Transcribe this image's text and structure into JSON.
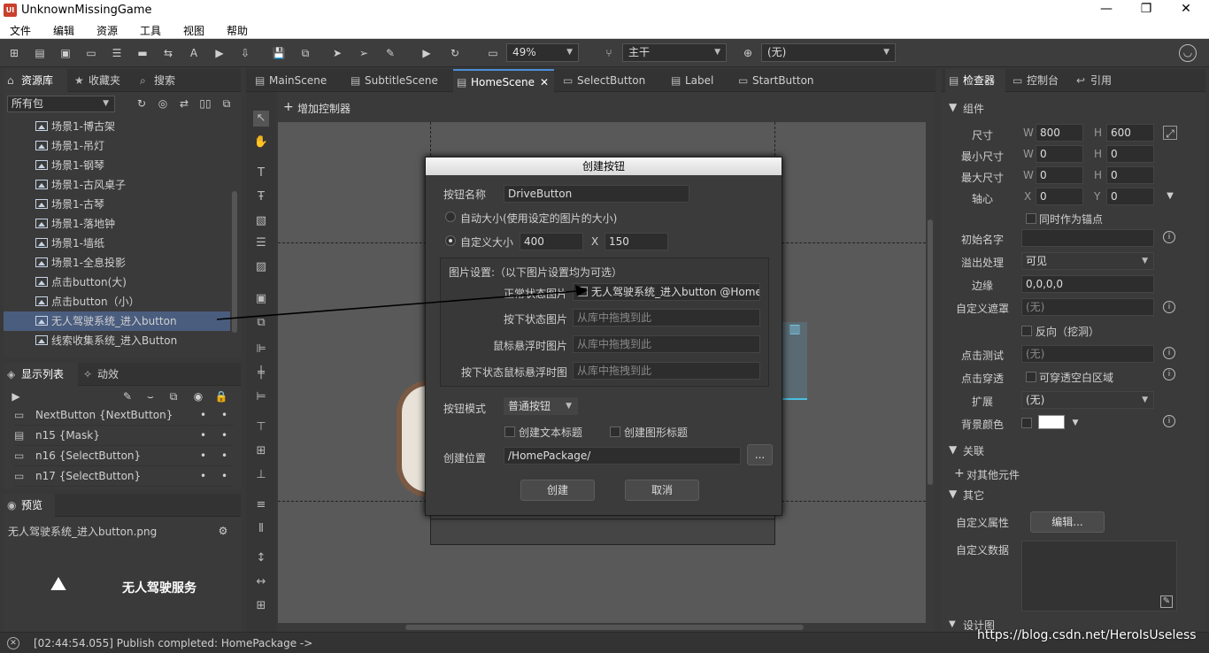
{
  "window": {
    "title": "UnknownMissingGame",
    "logo": "UI"
  },
  "menu": [
    "文件",
    "编辑",
    "资源",
    "工具",
    "视图",
    "帮助"
  ],
  "toolbar": {
    "zoom": "49%",
    "branch": "主干",
    "language": "(无)"
  },
  "left_tabs": {
    "library": "资源库",
    "favorites": "收藏夹",
    "search": "搜索"
  },
  "package_select": "所有包",
  "library_items": [
    "场景1-博古架",
    "场景1-吊灯",
    "场景1-钢琴",
    "场景1-古风桌子",
    "场景1-古琴",
    "场景1-落地钟",
    "场景1-墙纸",
    "场景1-全息投影",
    "点击button(大)",
    "点击button（小）",
    "无人驾驶系统_进入button",
    "线索收集系统_进入Button"
  ],
  "display_tabs": {
    "display_list": "显示列表",
    "effects": "动效"
  },
  "display_list": [
    "NextButton {NextButton}",
    "n15 {Mask}",
    "n16 {SelectButton}",
    "n17 {SelectButton}"
  ],
  "preview": {
    "tab": "预览",
    "filename": "无人驾驶系统_进入button.png",
    "image_text": "无人驾驶服务"
  },
  "doc_tabs": [
    "MainScene",
    "SubtitleScene",
    "HomeScene",
    "SelectButton",
    "Label",
    "StartButton"
  ],
  "add_controller": "增加控制器",
  "dialog": {
    "title": "创建按钮",
    "name_label": "按钮名称",
    "name_value": "DriveButton",
    "auto_size": "自动大小(使用设定的图片的大小)",
    "custom_size": "自定义大小",
    "width": "400",
    "height": "150",
    "x_sep": "X",
    "image_settings": "图片设置:（以下图片设置均为可选）",
    "normal_label": "正常状态图片",
    "normal_value": "无人驾驶系统_进入button @Home",
    "down_label": "按下状态图片",
    "hover_label": "鼠标悬浮时图片",
    "down_hover_label": "按下状态鼠标悬浮时图",
    "drag_placeholder": "从库中拖拽到此",
    "mode_label": "按钮模式",
    "mode_value": "普通按钮",
    "create_text_title": "创建文本标题",
    "create_graph_title": "创建图形标题",
    "location_label": "创建位置",
    "location_value": "/HomePackage/",
    "browse": "...",
    "create": "创建",
    "cancel": "取消"
  },
  "right_tabs": {
    "inspector": "检查器",
    "console": "控制台",
    "ref": "引用"
  },
  "inspector": {
    "section_component": "组件",
    "size": "尺寸",
    "w": "W",
    "h": "H",
    "x": "X",
    "y": "Y",
    "size_w": "800",
    "size_h": "600",
    "min_size": "最小尺寸",
    "min_w": "0",
    "min_h": "0",
    "max_size": "最大尺寸",
    "max_w": "0",
    "max_h": "0",
    "pivot": "轴心",
    "pivot_x": "0",
    "pivot_y": "0",
    "as_anchor": "同时作为锚点",
    "init_name": "初始名字",
    "overflow": "溢出处理",
    "overflow_value": "可见",
    "margin": "边缘",
    "margin_value": "0,0,0,0",
    "custom_mask": "自定义遮罩",
    "none": "(无)",
    "reverse": "反向（挖洞）",
    "hit_test": "点击测试",
    "click_through": "点击穿透",
    "click_through_opt": "可穿透空白区域",
    "extend": "扩展",
    "bg_color": "背景颜色",
    "section_relation": "关联",
    "add_relation": "对其他元件",
    "section_other": "其它",
    "custom_prop": "自定义属性",
    "edit_btn": "编辑...",
    "custom_data": "自定义数据",
    "section_more": "设计图"
  },
  "status": "[02:44:54.055] Publish completed: HomePackage ->",
  "watermark": "https://blog.csdn.net/HeroIsUseless",
  "colors": {
    "accent": "#4a5d7e",
    "dialog_bg": "#3b3b3b",
    "canvas": "#5a5a5a"
  }
}
